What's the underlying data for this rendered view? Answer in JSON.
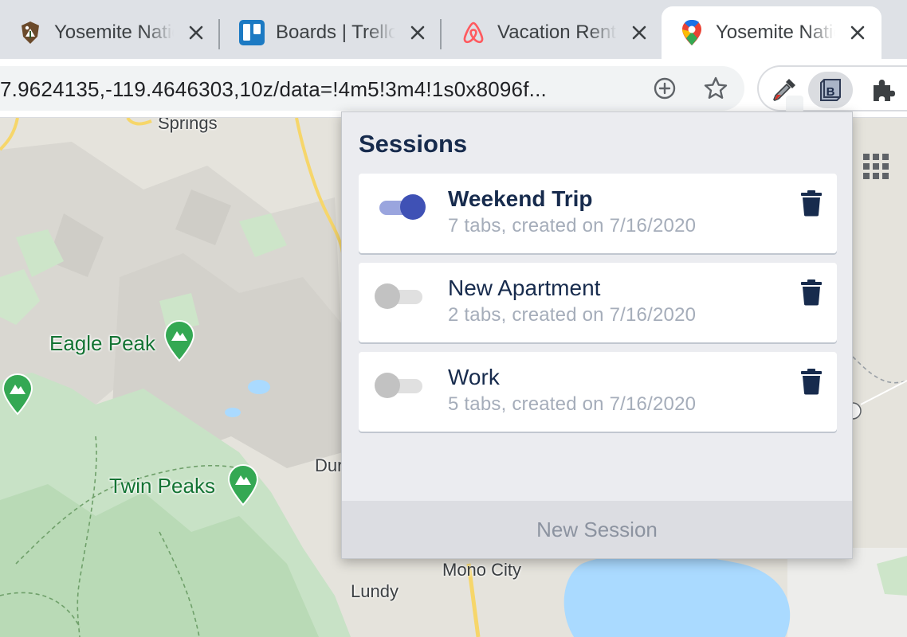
{
  "tabs": [
    {
      "title": "Yosemite National Park",
      "icon": "nps-arrowhead-icon",
      "active": false
    },
    {
      "title": "Boards | Trello",
      "icon": "trello-icon",
      "active": false
    },
    {
      "title": "Vacation Rentals",
      "icon": "airbnb-icon",
      "active": false
    },
    {
      "title": "Yosemite National Park",
      "icon": "google-maps-icon",
      "active": true
    }
  ],
  "address_bar": {
    "url": "7.9624135,-119.4646303,10z/data=!4m5!3m4!1s0x8096f..."
  },
  "extensions": [
    {
      "name": "eyedropper-extension",
      "icon": "eyedropper-icon"
    },
    {
      "name": "sessions-extension",
      "icon": "b-extension-icon",
      "label": "B"
    },
    {
      "name": "extensions-menu",
      "icon": "puzzle-icon"
    }
  ],
  "map": {
    "labels": [
      "Springs",
      "Dur",
      "Mono City",
      "Lundy"
    ],
    "peaks": [
      "Eagle Peak",
      "Twin Peaks"
    ]
  },
  "popup": {
    "title": "Sessions",
    "sessions": [
      {
        "name": "Weekend Trip",
        "meta": "7 tabs, created on 7/16/2020",
        "enabled": true
      },
      {
        "name": "New Apartment",
        "meta": "2 tabs, created on 7/16/2020",
        "enabled": false
      },
      {
        "name": "Work",
        "meta": "5 tabs, created on 7/16/2020",
        "enabled": false
      }
    ],
    "new_session_label": "New Session"
  },
  "colors": {
    "accent": "#3f51b5",
    "heading": "#172b4d",
    "muted": "#a5adba",
    "peak_green": "#137333"
  }
}
